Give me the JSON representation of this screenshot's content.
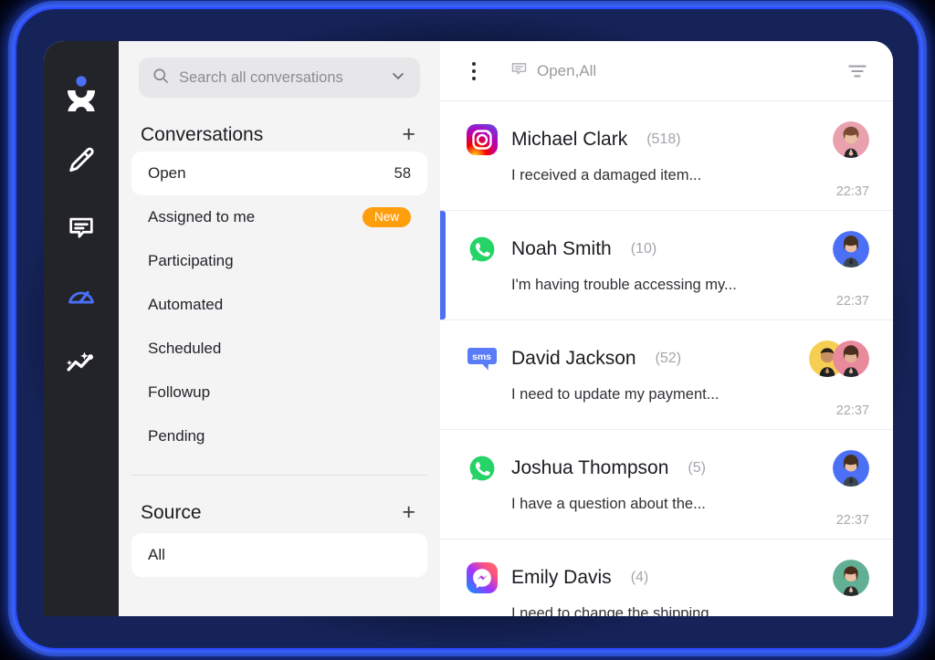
{
  "theme": {
    "accent": "#4B6FF5",
    "glow": "#3257FF",
    "rail_bg": "#23242A",
    "nav_bg": "#F4F4F5",
    "panel_bg": "#FFFFFF",
    "badge_orange": "#FF9E0D",
    "muted_text": "#A4A5AB"
  },
  "rail": {
    "items": [
      {
        "name": "app-logo",
        "icon": "person-x-logo-icon",
        "active": false
      },
      {
        "name": "compose",
        "icon": "pencil-icon",
        "active": false
      },
      {
        "name": "inbox",
        "icon": "chat-bubble-icon",
        "active": false
      },
      {
        "name": "dashboard",
        "icon": "gauge-icon",
        "active": true
      },
      {
        "name": "analytics",
        "icon": "sparkle-chart-icon",
        "active": false
      }
    ]
  },
  "search": {
    "placeholder": "Search all conversations",
    "value": "",
    "icon": "search-icon",
    "chevron": "chevron-down-icon"
  },
  "conversations_section": {
    "title": "Conversations",
    "add_label": "+",
    "items": [
      {
        "label": "Open",
        "count": "58",
        "badge": null,
        "active": true
      },
      {
        "label": "Assigned to me",
        "count": null,
        "badge": "New",
        "active": false
      },
      {
        "label": "Participating",
        "count": null,
        "badge": null,
        "active": false
      },
      {
        "label": "Automated",
        "count": null,
        "badge": null,
        "active": false
      },
      {
        "label": "Scheduled",
        "count": null,
        "badge": null,
        "active": false
      },
      {
        "label": "Followup",
        "count": null,
        "badge": null,
        "active": false
      },
      {
        "label": "Pending",
        "count": null,
        "badge": null,
        "active": false
      }
    ]
  },
  "source_section": {
    "title": "Source",
    "add_label": "+",
    "selected": "All"
  },
  "conv_header": {
    "kebab": "more-vertical-icon",
    "chat_icon": "chat-bubble-icon",
    "filter_label": "Open,All",
    "filter_icon": "filter-icon"
  },
  "conversations": [
    {
      "channel": "instagram",
      "name": "Michael Clark",
      "count": "(518)",
      "preview": "I received a damaged item...",
      "time": "22:37",
      "selected": false,
      "avatars": [
        {
          "bg": "#E9A1AE",
          "hair": "#7A4A34",
          "skin": "#E8BFA3",
          "shirt": "#25262B"
        }
      ]
    },
    {
      "channel": "whatsapp",
      "name": "Noah Smith",
      "count": "(10)",
      "preview": "I'm having trouble accessing my...",
      "time": "22:37",
      "selected": true,
      "avatars": [
        {
          "bg": "#4B6FF5",
          "hair": "#46301F",
          "skin": "#E8BFA3",
          "shirt": "#3C4650"
        }
      ]
    },
    {
      "channel": "sms",
      "name": "David Jackson",
      "count": "(52)",
      "preview": "I need to update my payment...",
      "time": "22:37",
      "selected": false,
      "avatars": [
        {
          "bg": "#F6CE52",
          "hair": "#2B2118",
          "skin": "#C99063",
          "shirt": "#1E1F23"
        },
        {
          "bg": "#E9899C",
          "hair": "#4B2E1E",
          "skin": "#E2B495",
          "shirt": "#25262B"
        }
      ]
    },
    {
      "channel": "whatsapp",
      "name": "Joshua Thompson",
      "count": "(5)",
      "preview": "I have a question about the...",
      "time": "22:37",
      "selected": false,
      "avatars": [
        {
          "bg": "#4B6FF5",
          "hair": "#46301F",
          "skin": "#E8BFA3",
          "shirt": "#3C4650"
        }
      ]
    },
    {
      "channel": "messenger",
      "name": "Emily Davis",
      "count": "(4)",
      "preview": "I need to change the shipping...",
      "time": "",
      "selected": false,
      "avatars": [
        {
          "bg": "#62B093",
          "hair": "#4A2C1C",
          "skin": "#E8BFA3",
          "shirt": "#2A2B30"
        }
      ]
    }
  ]
}
